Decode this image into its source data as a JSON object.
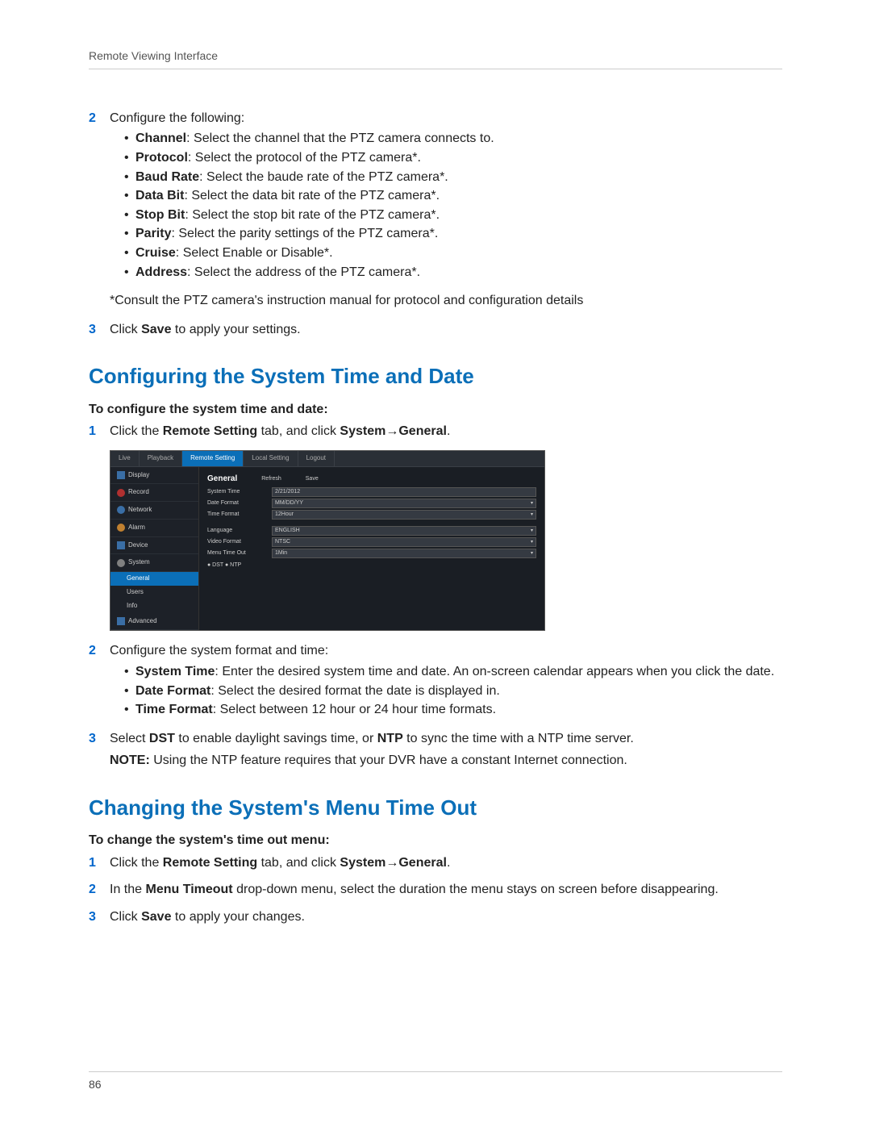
{
  "header": {
    "title": "Remote Viewing Interface"
  },
  "top_section": {
    "step2_num": "2",
    "step2_intro": "Configure the following:",
    "bullets": [
      {
        "label": "Channel",
        "text": ": Select the channel that the PTZ camera connects to."
      },
      {
        "label": "Protocol",
        "text": ": Select the protocol of the PTZ camera*."
      },
      {
        "label": "Baud Rate",
        "text": ": Select the baude rate of the PTZ camera*."
      },
      {
        "label": "Data Bit",
        "text": ": Select the data bit rate of the PTZ camera*."
      },
      {
        "label": "Stop Bit",
        "text": ": Select the stop bit rate of the PTZ camera*."
      },
      {
        "label": "Parity",
        "text": ": Select the parity settings of the PTZ camera*."
      },
      {
        "label": "Cruise",
        "text": ": Select Enable or Disable*."
      },
      {
        "label": "Address",
        "text": ": Select the address of the PTZ camera*."
      }
    ],
    "footnote": "*Consult the PTZ camera's instruction manual for protocol and configuration details",
    "step3_num": "3",
    "step3_pre": "Click ",
    "step3_bold": "Save",
    "step3_post": " to apply your settings."
  },
  "section1": {
    "heading": "Configuring the System Time and Date",
    "sub": "To configure the system time and date:",
    "step1_num": "1",
    "step1_pre": "Click the ",
    "step1_b1": "Remote Setting",
    "step1_mid": " tab, and click ",
    "step1_b2": "System",
    "arrow": "→",
    "step1_b3": "General",
    "step1_post": ".",
    "step2_num": "2",
    "step2_intro": "Configure the system format and time:",
    "bullets": [
      {
        "label": "System Time",
        "text": ": Enter the desired system time and date. An on-screen calendar appears when you click the date."
      },
      {
        "label": "Date Format",
        "text": ": Select the desired format the date is displayed in."
      },
      {
        "label": "Time Format",
        "text": ": Select between 12 hour or 24 hour time formats."
      }
    ],
    "step3_num": "3",
    "step3_pre": "Select ",
    "step3_b1": "DST",
    "step3_mid": " to enable daylight savings time, or ",
    "step3_b2": "NTP",
    "step3_post": " to sync the time with a NTP time server.",
    "note_label": "NOTE:",
    "note_text": " Using the NTP feature requires that your DVR have a constant Internet connection."
  },
  "section2": {
    "heading": "Changing the System's Menu Time Out",
    "sub": "To change the system's time out menu:",
    "step1_num": "1",
    "step1_pre": "Click the ",
    "step1_b1": "Remote Setting",
    "step1_mid": " tab, and click ",
    "step1_b2": "System",
    "arrow": "→",
    "step1_b3": "General",
    "step1_post": ".",
    "step2_num": "2",
    "step2_pre": "In the ",
    "step2_b1": "Menu Timeout",
    "step2_post": " drop-down menu, select the duration the menu stays on screen before disappearing.",
    "step3_num": "3",
    "step3_pre": "Click ",
    "step3_b1": "Save",
    "step3_post": " to apply your changes."
  },
  "screenshot": {
    "tabs": [
      "Live",
      "Playback",
      "Remote Setting",
      "Local Setting",
      "Logout"
    ],
    "active_tab": "Remote Setting",
    "sidebar": [
      "Display",
      "Record",
      "Network",
      "Alarm",
      "Device",
      "System"
    ],
    "sidebar_sub": [
      "General",
      "Users",
      "Info"
    ],
    "sidebar_last": "Advanced",
    "panel_title": "General",
    "panel_buttons": [
      "Refresh",
      "Save"
    ],
    "rows": [
      {
        "label": "System Time",
        "value": "2/21/2012"
      },
      {
        "label": "Date Format",
        "value": "MM/DD/YY"
      },
      {
        "label": "Time Format",
        "value": "12Hour"
      },
      {
        "label": "Language",
        "value": "ENGLISH"
      },
      {
        "label": "Video Format",
        "value": "NTSC"
      },
      {
        "label": "Menu Time Out",
        "value": "1Min"
      }
    ],
    "radios": "● DST   ● NTP"
  },
  "footer": {
    "page": "86"
  }
}
